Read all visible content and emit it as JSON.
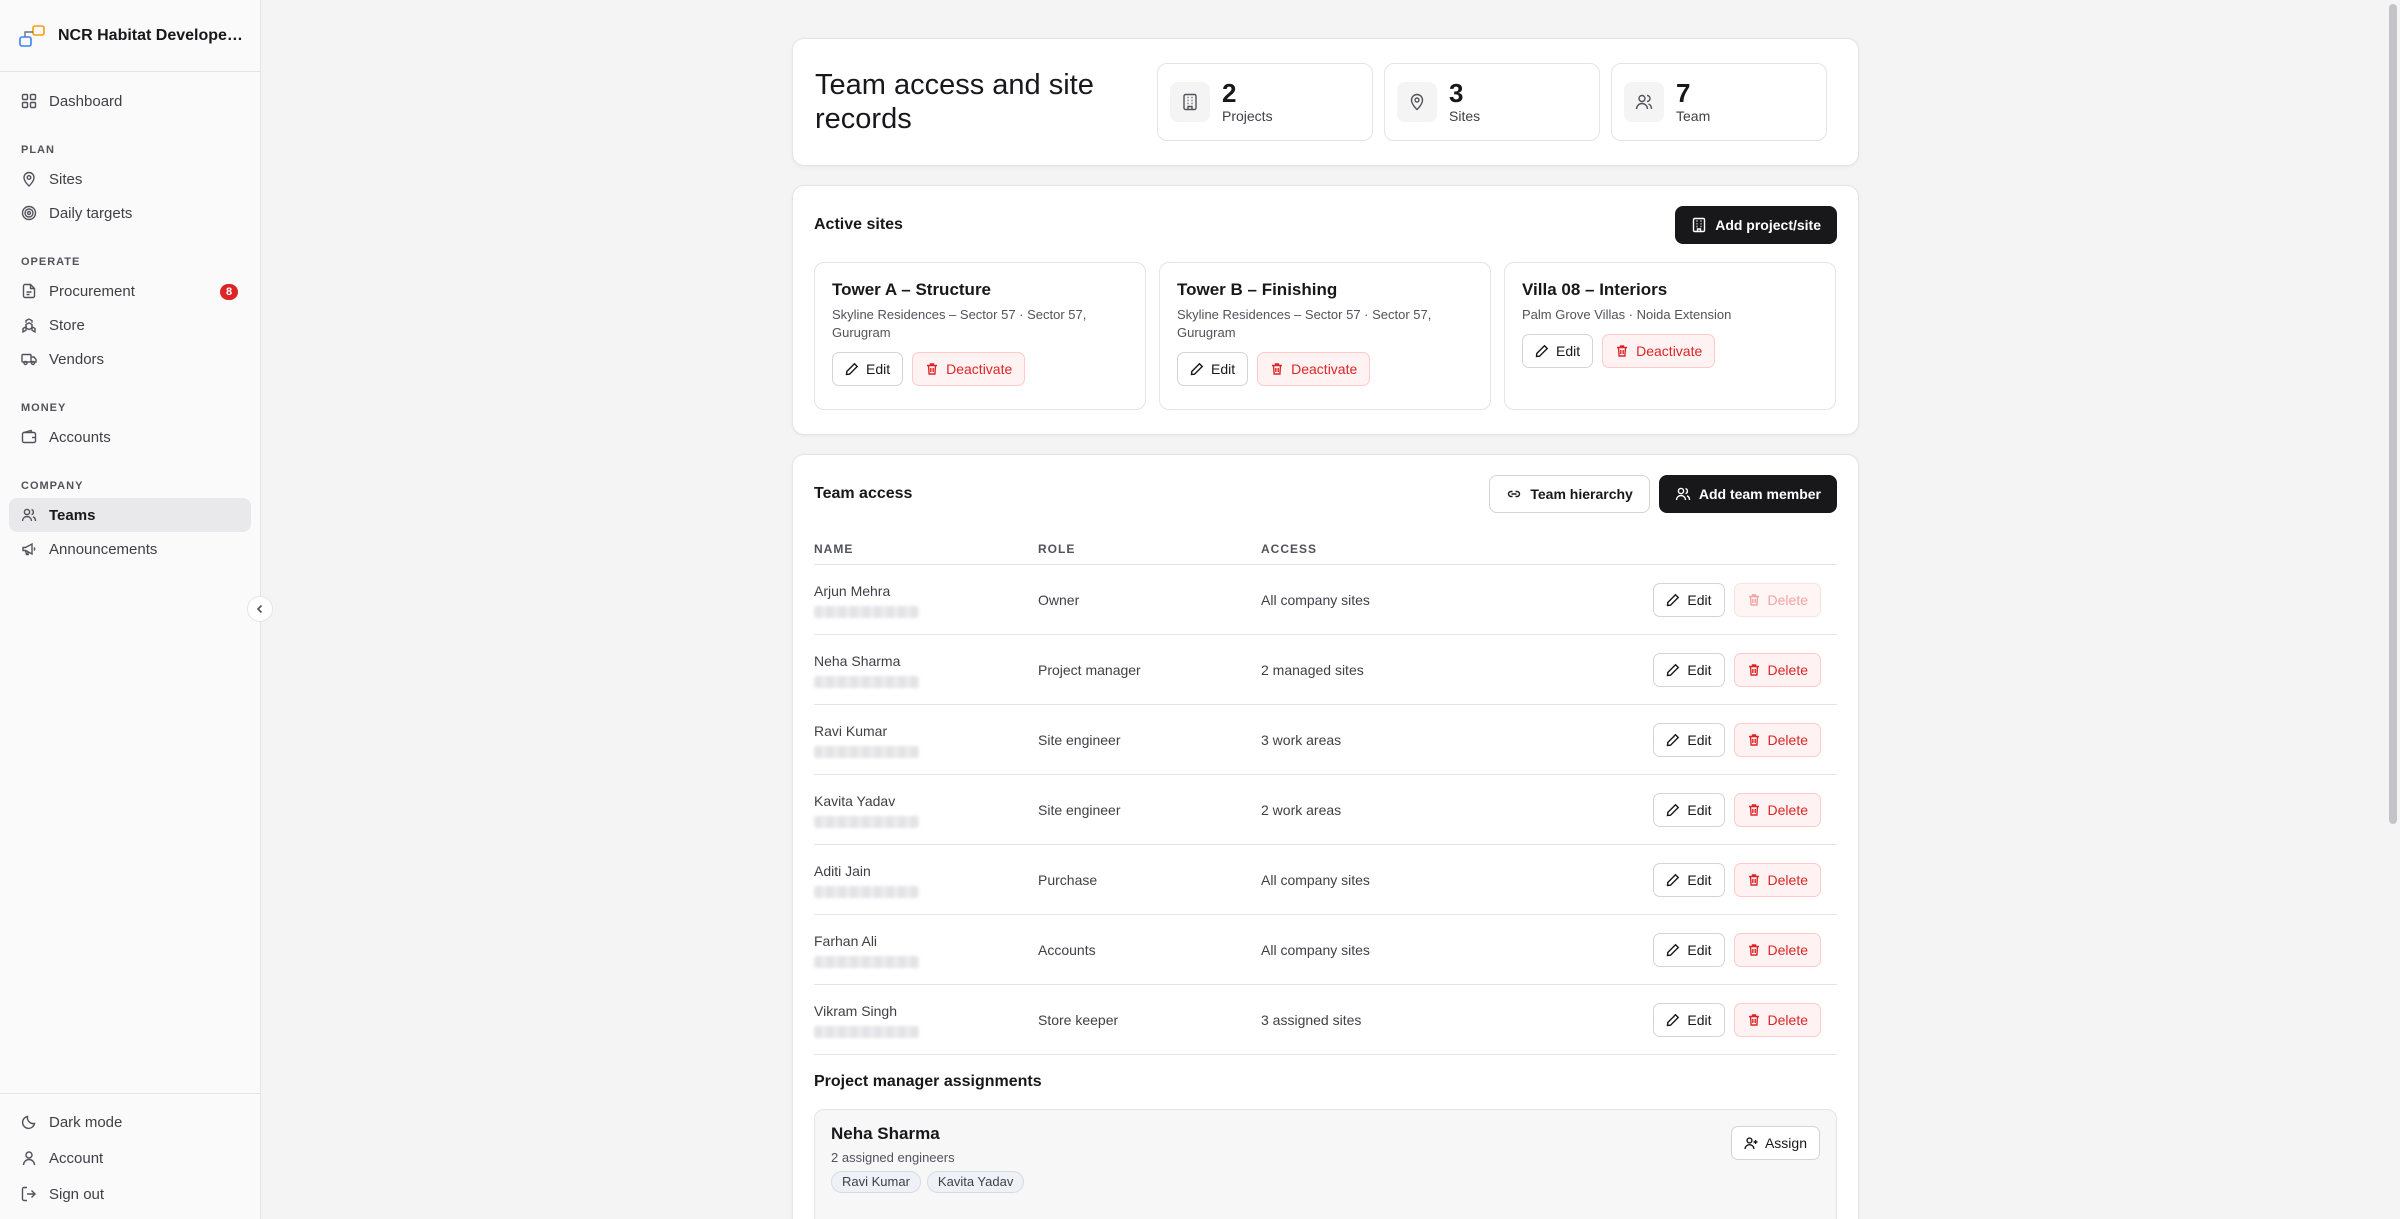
{
  "sidebar": {
    "brand": "NCR Habitat Developers · …",
    "dashboard": "Dashboard",
    "sections": {
      "plan": "PLAN",
      "operate": "OPERATE",
      "money": "MONEY",
      "company": "COMPANY"
    },
    "items": {
      "sites": "Sites",
      "daily_targets": "Daily targets",
      "procurement": "Procurement",
      "procurement_badge": "8",
      "store": "Store",
      "vendors": "Vendors",
      "accounts": "Accounts",
      "teams": "Teams",
      "announcements": "Announcements"
    },
    "active_item": "Teams",
    "bottom": {
      "dark_mode": "Dark mode",
      "account": "Account",
      "sign_out": "Sign out"
    }
  },
  "header": {
    "title": "Team access and site records",
    "stats": [
      {
        "value": "2",
        "label": "Projects",
        "icon": "building-icon"
      },
      {
        "value": "3",
        "label": "Sites",
        "icon": "map-pin-icon"
      },
      {
        "value": "7",
        "label": "Team",
        "icon": "users-icon"
      }
    ]
  },
  "sites": {
    "title": "Active sites",
    "add_button": "Add project/site",
    "edit_label": "Edit",
    "deactivate_label": "Deactivate",
    "items": [
      {
        "name": "Tower A – Structure",
        "location": "Skyline Residences – Sector 57 · Sector 57, Gurugram"
      },
      {
        "name": "Tower B – Finishing",
        "location": "Skyline Residences – Sector 57 · Sector 57, Gurugram"
      },
      {
        "name": "Villa 08 – Interiors",
        "location": "Palm Grove Villas · Noida Extension"
      }
    ]
  },
  "team": {
    "title": "Team access",
    "hierarchy_button": "Team hierarchy",
    "add_button": "Add team member",
    "columns": {
      "name": "NAME",
      "role": "ROLE",
      "access": "ACCESS"
    },
    "edit_label": "Edit",
    "delete_label": "Delete",
    "members": [
      {
        "name": "Arjun Mehra",
        "role": "Owner",
        "access": "All company sites"
      },
      {
        "name": "Neha Sharma",
        "role": "Project manager",
        "access": "2 managed sites"
      },
      {
        "name": "Ravi Kumar",
        "role": "Site engineer",
        "access": "3 work areas"
      },
      {
        "name": "Kavita Yadav",
        "role": "Site engineer",
        "access": "2 work areas"
      },
      {
        "name": "Aditi Jain",
        "role": "Purchase",
        "access": "All company sites"
      },
      {
        "name": "Farhan Ali",
        "role": "Accounts",
        "access": "All company sites"
      },
      {
        "name": "Vikram Singh",
        "role": "Store keeper",
        "access": "3 assigned sites"
      }
    ]
  },
  "pm_assignments": {
    "title": "Project manager assignments",
    "manager": "Neha Sharma",
    "count_text": "2 assigned engineers",
    "engineers": [
      "Ravi Kumar",
      "Kavita Yadav"
    ],
    "assign_button": "Assign"
  },
  "colors": {
    "accent_dark": "#18181b",
    "danger": "#dc2626",
    "active_nav_bg": "#e9e9eb"
  }
}
